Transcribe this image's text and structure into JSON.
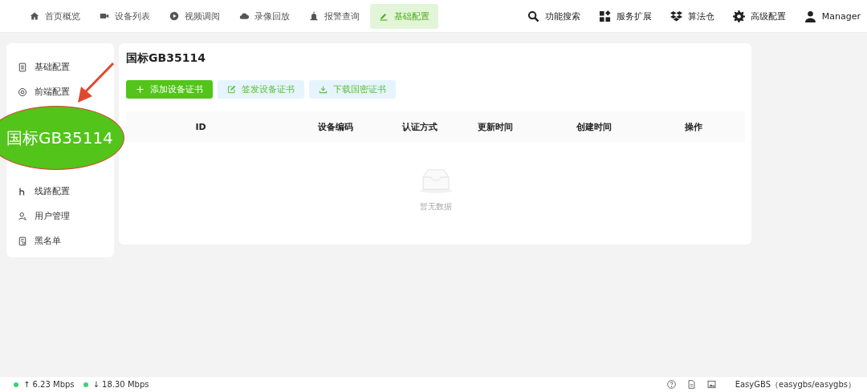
{
  "top_nav": {
    "items": [
      {
        "label": "首页概览",
        "selected": false
      },
      {
        "label": "设备列表",
        "selected": false
      },
      {
        "label": "视频调阅",
        "selected": false
      },
      {
        "label": "录像回放",
        "selected": false
      },
      {
        "label": "报警查询",
        "selected": false
      },
      {
        "label": "基础配置",
        "selected": true
      }
    ],
    "tools": [
      {
        "label": "功能搜索"
      },
      {
        "label": "服务扩展"
      },
      {
        "label": "算法仓"
      },
      {
        "label": "高级配置"
      },
      {
        "label": "Manager"
      }
    ]
  },
  "sidebar": {
    "items": [
      {
        "label": "基础配置"
      },
      {
        "label": "前端配置"
      },
      {
        "label": "线路配置"
      },
      {
        "label": "用户管理"
      },
      {
        "label": "黑名单"
      }
    ]
  },
  "annotation": {
    "label": "国标GB35114"
  },
  "panel": {
    "title": "国标GB35114",
    "buttons": [
      {
        "label": "添加设备证书",
        "kind": "primary"
      },
      {
        "label": "签发设备证书",
        "kind": "light"
      },
      {
        "label": "下载国密证书",
        "kind": "light"
      }
    ],
    "table": {
      "columns": [
        "ID",
        "设备编码",
        "认证方式",
        "更新时间",
        "创建时间",
        "操作"
      ],
      "empty_text": "暂无数据"
    }
  },
  "status_bar": {
    "upload": "↑ 6.23 Mbps",
    "download": "↓ 18.30 Mbps",
    "version": "EasyGBS（easygbs/easygbs）"
  }
}
